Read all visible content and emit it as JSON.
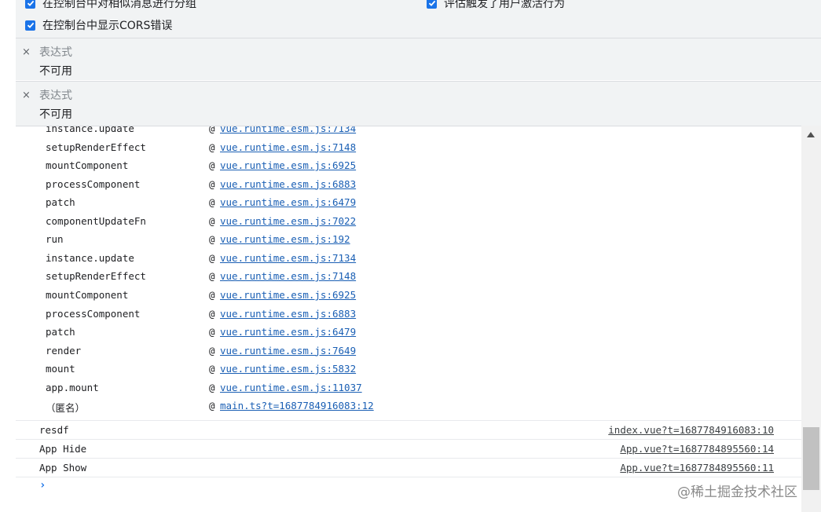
{
  "settings": {
    "options": [
      {
        "label": "在控制台中对相似消息进行分组",
        "checked": true
      },
      {
        "label": "评估触发了用户激活行为",
        "checked": true
      },
      {
        "label": "在控制台中显示CORS错误",
        "checked": true
      }
    ]
  },
  "watch": [
    {
      "remove": "×",
      "expression": "表达式",
      "value": "不可用"
    },
    {
      "remove": "×",
      "expression": "表达式",
      "value": "不可用"
    }
  ],
  "stack": [
    {
      "fn": "instance.update",
      "at": "@",
      "src": "vue.runtime.esm.js:7134"
    },
    {
      "fn": "setupRenderEffect",
      "at": "@",
      "src": "vue.runtime.esm.js:7148"
    },
    {
      "fn": "mountComponent",
      "at": "@",
      "src": "vue.runtime.esm.js:6925"
    },
    {
      "fn": "processComponent",
      "at": "@",
      "src": "vue.runtime.esm.js:6883"
    },
    {
      "fn": "patch",
      "at": "@",
      "src": "vue.runtime.esm.js:6479"
    },
    {
      "fn": "componentUpdateFn",
      "at": "@",
      "src": "vue.runtime.esm.js:7022"
    },
    {
      "fn": "run",
      "at": "@",
      "src": "vue.runtime.esm.js:192"
    },
    {
      "fn": "instance.update",
      "at": "@",
      "src": "vue.runtime.esm.js:7134"
    },
    {
      "fn": "setupRenderEffect",
      "at": "@",
      "src": "vue.runtime.esm.js:7148"
    },
    {
      "fn": "mountComponent",
      "at": "@",
      "src": "vue.runtime.esm.js:6925"
    },
    {
      "fn": "processComponent",
      "at": "@",
      "src": "vue.runtime.esm.js:6883"
    },
    {
      "fn": "patch",
      "at": "@",
      "src": "vue.runtime.esm.js:6479"
    },
    {
      "fn": "render",
      "at": "@",
      "src": "vue.runtime.esm.js:7649"
    },
    {
      "fn": "mount",
      "at": "@",
      "src": "vue.runtime.esm.js:5832"
    },
    {
      "fn": "app.mount",
      "at": "@",
      "src": "vue.runtime.esm.js:11037"
    },
    {
      "fn": "（匿名）",
      "at": "@",
      "src": "main.ts?t=1687784916083:12"
    }
  ],
  "logs": [
    {
      "message": "resdf",
      "source": "index.vue?t=1687784916083:10"
    },
    {
      "message": "App Hide",
      "source": "App.vue?t=1687784895560:14"
    },
    {
      "message": "App Show",
      "source": "App.vue?t=1687784895560:11"
    }
  ],
  "prompt": "›",
  "watermark": "@稀土掘金技术社区",
  "colors": {
    "checkbox": "#1a73e8",
    "link": "#1a5fb4",
    "panel": "#f1f3f4"
  }
}
